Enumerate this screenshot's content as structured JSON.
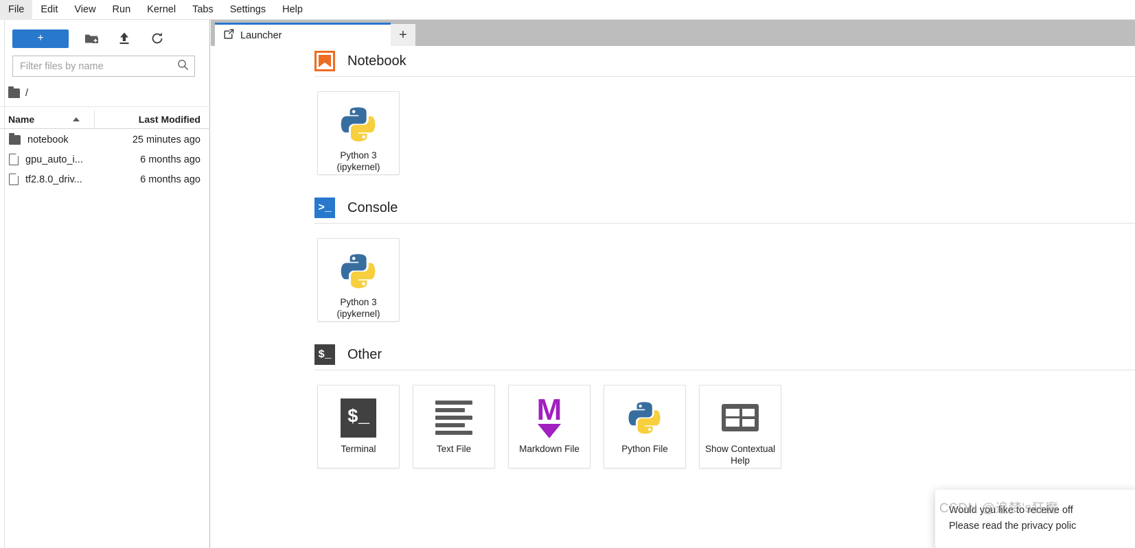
{
  "menubar": {
    "items": [
      {
        "label": "File",
        "active": true
      },
      {
        "label": "Edit",
        "active": false
      },
      {
        "label": "View",
        "active": false
      },
      {
        "label": "Run",
        "active": false
      },
      {
        "label": "Kernel",
        "active": false
      },
      {
        "label": "Tabs",
        "active": false
      },
      {
        "label": "Settings",
        "active": false
      },
      {
        "label": "Help",
        "active": false
      }
    ]
  },
  "sidebar": {
    "toolbar": {
      "new_label": "+",
      "new_folder_icon": "new-folder-icon",
      "upload_icon": "upload-icon",
      "refresh_icon": "refresh-icon"
    },
    "filter": {
      "placeholder": "Filter files by name",
      "value": "",
      "search_icon": "search-icon"
    },
    "breadcrumb": {
      "folder_icon": "folder-icon",
      "path": "/"
    },
    "columns": {
      "name": "Name",
      "last_modified": "Last Modified",
      "sort_caret_icon": "sort-ascending-caret-icon"
    },
    "files": [
      {
        "name": "notebook",
        "modified": "25 minutes ago",
        "icon": "folder-icon"
      },
      {
        "name": "gpu_auto_i...",
        "modified": "6 months ago",
        "icon": "file-icon"
      },
      {
        "name": "tf2.8.0_driv...",
        "modified": "6 months ago",
        "icon": "file-icon"
      }
    ]
  },
  "main": {
    "tab": {
      "label": "Launcher",
      "icon": "launcher-icon"
    },
    "add_tab_label": "+"
  },
  "launcher": {
    "sections": [
      {
        "title": "Notebook",
        "icon": "notebook-bookmark-icon",
        "cards": [
          {
            "label": "Python 3\n(ipykernel)",
            "line1": "Python 3",
            "line2": "(ipykernel)",
            "icon": "python-logo-icon"
          }
        ]
      },
      {
        "title": "Console",
        "icon": "console-prompt-icon",
        "icon_glyph": ">_",
        "cards": [
          {
            "label": "Python 3\n(ipykernel)",
            "line1": "Python 3",
            "line2": "(ipykernel)",
            "icon": "python-logo-icon"
          }
        ]
      },
      {
        "title": "Other",
        "icon": "shell-prompt-icon",
        "icon_glyph": "$_",
        "cards": [
          {
            "label": "Terminal",
            "line1": "Terminal",
            "line2": "",
            "icon": "terminal-icon"
          },
          {
            "label": "Text File",
            "line1": "Text File",
            "line2": "",
            "icon": "text-file-icon"
          },
          {
            "label": "Markdown File",
            "line1": "Markdown File",
            "line2": "",
            "icon": "markdown-icon"
          },
          {
            "label": "Python File",
            "line1": "Python File",
            "line2": "",
            "icon": "python-logo-icon"
          },
          {
            "label": "Show Contextual Help",
            "line1": "Show Contextual",
            "line2": "Help",
            "icon": "contextual-help-icon"
          }
        ]
      }
    ]
  },
  "toast": {
    "line1": "Would you like to receive off",
    "line2": "Please read the privacy polic"
  },
  "watermark": {
    "text": "CSDN @追梦's狂魔"
  },
  "colors": {
    "accent_blue": "#2878cd",
    "notebook_orange": "#ee6c21",
    "markdown_purple": "#a020c0",
    "dark_gray": "#414141",
    "tabbar_gray": "#bdbdbd"
  }
}
